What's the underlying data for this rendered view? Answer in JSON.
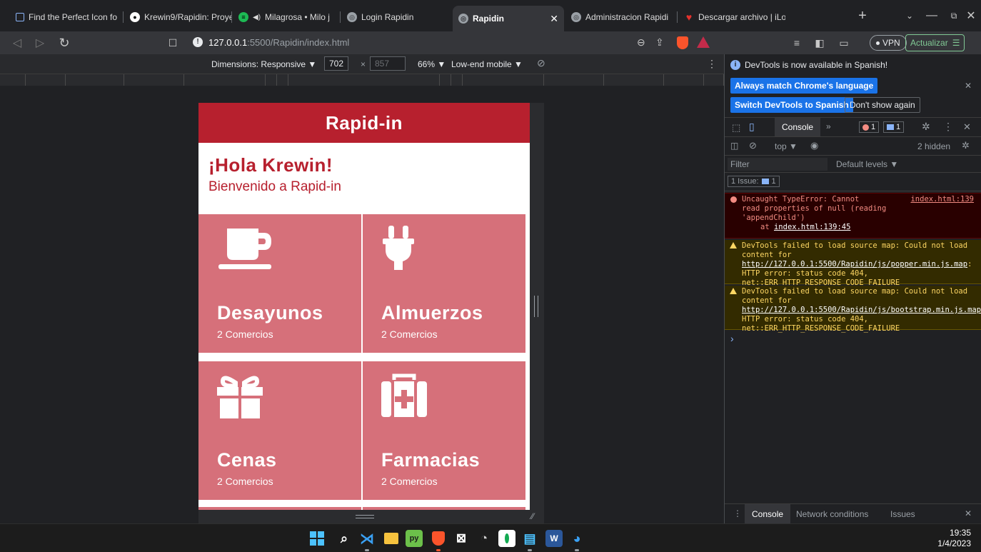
{
  "browser": {
    "tabs": [
      {
        "label": "Find the Perfect Icon fo"
      },
      {
        "label": "Krewin9/Rapidin: Proye"
      },
      {
        "label": "Milagrosa • Milo j"
      },
      {
        "label": "Login Rapidin"
      },
      {
        "label": "Rapidin",
        "active": true
      },
      {
        "label": "Administracion Rapidi"
      },
      {
        "label": "Descargar archivo | iLo"
      }
    ],
    "url_host": "127.0.0.1",
    "url_path": ":5500/Rapidin/index.html",
    "vpn_label": "VPN",
    "update_label": "Actualizar"
  },
  "device_toolbar": {
    "dimensions_label": "Dimensions: Responsive ▼",
    "width_value": "702",
    "height_value": "857",
    "times": "×",
    "zoom_label": "66% ▼",
    "throttle_label": "Low-end mobile ▼"
  },
  "app": {
    "header_title": "Rapid-in",
    "greeting": "¡Hola Krewin!",
    "welcome": "Bienvenido a Rapid-in",
    "cards": [
      {
        "title": "Desayunos",
        "sub": "2 Comercios",
        "icon": "coffee-cup-icon"
      },
      {
        "title": "Almuerzos",
        "sub": "2 Comercios",
        "icon": "plug-icon"
      },
      {
        "title": "Cenas",
        "sub": "2 Comercios",
        "icon": "gift-icon"
      },
      {
        "title": "Farmacias",
        "sub": "2 Comercios",
        "icon": "medical-kit-icon"
      }
    ],
    "colors": {
      "brand": "#b7202e",
      "card": "#d6707a"
    }
  },
  "devtools": {
    "banner_text": "DevTools is now available in Spanish!",
    "match_button": "Always match Chrome's language",
    "switch_button": "Switch DevTools to Spanish",
    "dismiss_button": "Don't show again",
    "console_tab": "Console",
    "error_count": "1",
    "issue_count": "1",
    "context_label": "top ▼",
    "hidden_label": "2 hidden",
    "filter_placeholder": "Filter",
    "levels_label": "Default levels ▼",
    "issues_label": "1 Issue:",
    "issues_num": "1",
    "error": {
      "text_1": "Uncaught TypeError: Cannot",
      "link": "index.html:139",
      "text_2": "read properties of null (reading",
      "text_3": "'appendChild')",
      "at": "at",
      "at_link": "index.html:139:45"
    },
    "warn1": {
      "pre": "DevTools failed to load source map: Could not load content for ",
      "url": "http://127.0.0.1:5500/Rapidin/js/popper.min.js.map",
      "post": ": HTTP error: status code 404, net::ERR_HTTP_RESPONSE_CODE_FAILURE"
    },
    "warn2": {
      "pre": "DevTools failed to load source map: Could not load content for ",
      "url": "http://127.0.0.1:5500/Rapidin/js/bootstrap.min.js.map",
      "post": ": HTTP error: status code 404, net::ERR_HTTP_RESPONSE_CODE_FAILURE"
    },
    "prompt": "›",
    "drawer_tabs": [
      "Console",
      "Network conditions",
      "Issues"
    ]
  },
  "taskbar": {
    "time": "19:35",
    "date": "1/4/2023"
  }
}
